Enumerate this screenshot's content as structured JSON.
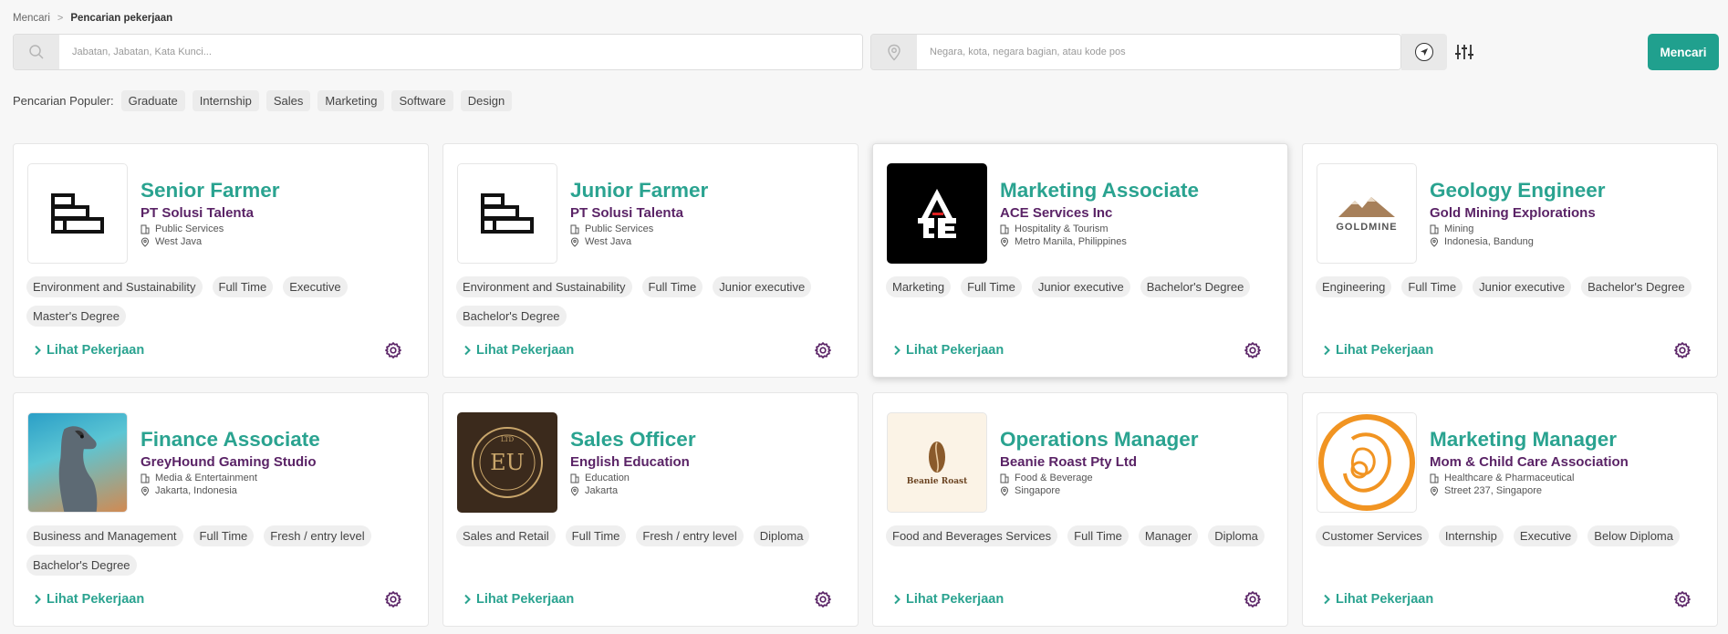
{
  "breadcrumb": {
    "parent": "Mencari",
    "separator": ">",
    "current": "Pencarian pekerjaan"
  },
  "search": {
    "keyword_placeholder": "Jabatan, Jabatan, Kata Kunci...",
    "location_placeholder": "Negara, kota, negara bagian, atau kode pos",
    "button_label": "Mencari",
    "accent_color": "#20a08e"
  },
  "popular": {
    "label": "Pencarian Populer:",
    "chips": [
      "Graduate",
      "Internship",
      "Sales",
      "Marketing",
      "Software",
      "Design"
    ]
  },
  "colors": {
    "title": "#2aa390",
    "company": "#5a2366",
    "gear": "#5a2366"
  },
  "jobs": [
    {
      "title": "Senior Farmer",
      "company": "PT Solusi Talenta",
      "industry": "Public Services",
      "location": "West Java",
      "logo": "building-blocks-logo",
      "tags": [
        "Environment and Sustainability",
        "Full Time",
        "Executive",
        "Master's Degree"
      ],
      "link": "Lihat Pekerjaan"
    },
    {
      "title": "Junior Farmer",
      "company": "PT Solusi Talenta",
      "industry": "Public Services",
      "location": "West Java",
      "logo": "building-blocks-logo",
      "tags": [
        "Environment and Sustainability",
        "Full Time",
        "Junior executive",
        "Bachelor's Degree"
      ],
      "link": "Lihat Pekerjaan"
    },
    {
      "title": "Marketing Associate",
      "company": "ACE Services Inc",
      "industry": "Hospitality & Tourism",
      "location": "Metro Manila, Philippines",
      "logo": "ace-logo",
      "tags": [
        "Marketing",
        "Full Time",
        "Junior executive",
        "Bachelor's Degree"
      ],
      "link": "Lihat Pekerjaan"
    },
    {
      "title": "Geology Engineer",
      "company": "Gold Mining Explorations",
      "industry": "Mining",
      "location": "Indonesia, Bandung",
      "logo": "goldmine-logo",
      "logo_text": "GOLDMINE",
      "tags": [
        "Engineering",
        "Full Time",
        "Junior executive",
        "Bachelor's Degree"
      ],
      "link": "Lihat Pekerjaan"
    },
    {
      "title": "Finance Associate",
      "company": "GreyHound Gaming Studio",
      "industry": "Media & Entertainment",
      "location": "Jakarta, Indonesia",
      "logo": "greyhound-logo",
      "tags": [
        "Business and Management",
        "Full Time",
        "Fresh / entry level",
        "Bachelor's Degree"
      ],
      "link": "Lihat Pekerjaan"
    },
    {
      "title": "Sales Officer",
      "company": "English Education",
      "industry": "Education",
      "location": "Jakarta",
      "logo": "english-education-logo",
      "tags": [
        "Sales and Retail",
        "Full Time",
        "Fresh / entry level",
        "Diploma"
      ],
      "link": "Lihat Pekerjaan"
    },
    {
      "title": "Operations Manager",
      "company": "Beanie Roast Pty Ltd",
      "industry": "Food & Beverage",
      "location": "Singapore",
      "logo": "beanie-roast-logo",
      "logo_text": "Beanie Roast",
      "tags": [
        "Food and Beverages Services",
        "Full Time",
        "Manager",
        "Diploma"
      ],
      "link": "Lihat Pekerjaan"
    },
    {
      "title": "Marketing Manager",
      "company": "Mom & Child Care Association",
      "industry": "Healthcare & Pharmaceutical",
      "location": "Street 237, Singapore",
      "logo": "mom-child-logo",
      "tags": [
        "Customer Services",
        "Internship",
        "Executive",
        "Below Diploma"
      ],
      "link": "Lihat Pekerjaan"
    }
  ]
}
